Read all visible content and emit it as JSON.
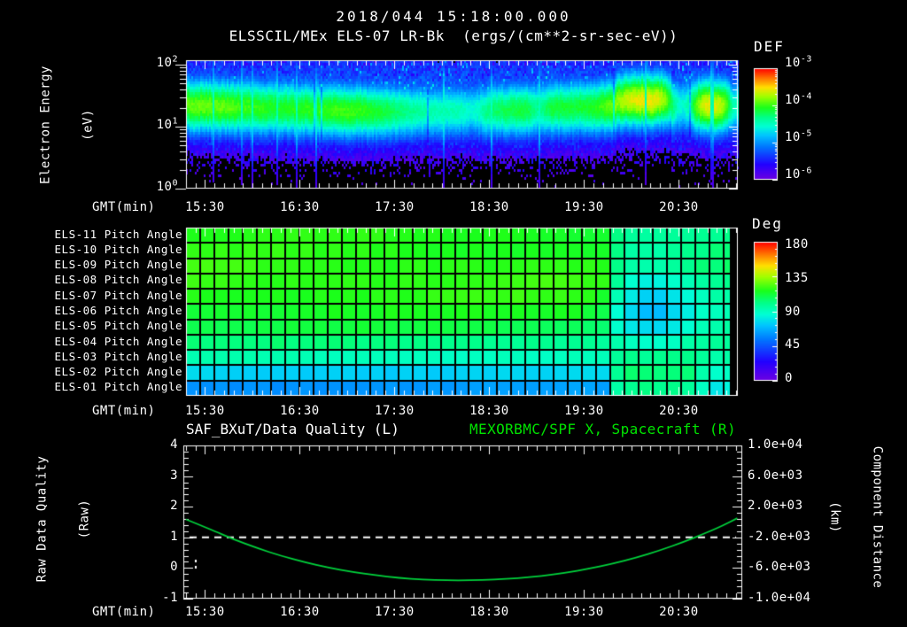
{
  "header": {
    "date_title": "2018/044 15:18:00.000",
    "instrument_title": "ELSSCIL/MEx ELS-07 LR-Bk  (ergs/(cm**2-sr-sec-eV))"
  },
  "colors": {
    "background": "#000000",
    "text": "#ffffff",
    "title_green": "#00e400",
    "curve_green": "#00d23c",
    "frame_white": "#ffffff",
    "grid_line": "#000000",
    "quality_line": "#ffffff"
  },
  "colormap_stops": [
    [
      0,
      "#7000e0"
    ],
    [
      0.14,
      "#2200ff"
    ],
    [
      0.3,
      "#0077ff"
    ],
    [
      0.4,
      "#00c4ff"
    ],
    [
      0.48,
      "#00ffd5"
    ],
    [
      0.56,
      "#00ff8c"
    ],
    [
      0.65,
      "#1aff1a"
    ],
    [
      0.75,
      "#a0ff00"
    ],
    [
      0.83,
      "#ffe000"
    ],
    [
      0.91,
      "#ff7a00"
    ],
    [
      1,
      "#ff0000"
    ]
  ],
  "time_axis": {
    "label": "GMT(min)",
    "tick_labels": [
      "15:30",
      "16:30",
      "17:30",
      "18:30",
      "19:30",
      "20:30"
    ],
    "tick_minutes": [
      12,
      72,
      132,
      192,
      252,
      312
    ],
    "start_time": "15:18",
    "minutes_span": 349
  },
  "spectrogram": {
    "ylabel_line1": "Electron Energy",
    "ylabel_line2": "(eV)",
    "ytick_labels": [
      {
        "base": "10",
        "exp": "2"
      },
      {
        "base": "10",
        "exp": "1"
      },
      {
        "base": "10",
        "exp": "0"
      }
    ]
  },
  "def_colorbar": {
    "label": "DEF",
    "tick_labels": [
      {
        "base": "10",
        "exp": "-3"
      },
      {
        "base": "10",
        "exp": "-4"
      },
      {
        "base": "10",
        "exp": "-5"
      },
      {
        "base": "10",
        "exp": "-6"
      }
    ]
  },
  "deg_colorbar": {
    "label": "Deg",
    "tick_labels": [
      "180",
      "135",
      "90",
      "45",
      "0"
    ]
  },
  "pitch": {
    "row_labels": [
      "ELS-11 Pitch Angle",
      "ELS-10 Pitch Angle",
      "ELS-09 Pitch Angle",
      "ELS-08 Pitch Angle",
      "ELS-07 Pitch Angle",
      "ELS-06 Pitch Angle",
      "ELS-05 Pitch Angle",
      "ELS-04 Pitch Angle",
      "ELS-03 Pitch Angle",
      "ELS-02 Pitch Angle",
      "ELS-01 Pitch Angle"
    ]
  },
  "bottom": {
    "title_left": "SAF_BXuT/Data Quality (L)",
    "title_right": "MEXORBMC/SPF X, Spacecraft (R)",
    "left_tick_labels": [
      "4",
      "3",
      "2",
      "1",
      "0",
      "-1"
    ],
    "right_tick_labels": [
      "1.0e+04",
      "6.0e+03",
      "2.0e+03",
      "-2.0e+03",
      "-6.0e+03",
      "-1.0e+04"
    ],
    "ylabel_left_line1": "Raw Data Quality",
    "ylabel_left_line2": "(Raw)",
    "ylabel_right_line1": "Component Distance",
    "ylabel_right_line2": "(km)"
  },
  "chart_data": [
    {
      "type": "heatmap",
      "panel": "electron_energy_spectrogram",
      "title": "ELSSCIL/MEx ELS-07 LR-Bk",
      "units": "ergs/(cm**2-sr-sec-eV)",
      "xlabel": "GMT(min)",
      "x_ticks": [
        "15:30",
        "16:30",
        "17:30",
        "18:30",
        "19:30",
        "20:30"
      ],
      "x_range": [
        "15:18",
        "21:07"
      ],
      "ylabel": "Electron Energy (eV)",
      "y_scale": "log",
      "y_range_ev": [
        1,
        117
      ],
      "colorbar": {
        "label": "DEF",
        "range_exponents": [
          -6,
          -3
        ]
      },
      "description": "Broad enhanced electron flux band between ~10 and ~60 eV near the 1e-4 level (green) across the whole interval; blue ~1e-5 speckle above the band; violet/black noise below ~8 eV; brighter yellow-green patches near 19:55-20:25 and 20:45-21:00; dim cyan gap near 20:35; narrow tall cyan streaks near 15:25, 18:15, 19:00 and 20:40.",
      "render": {
        "band_center_log_ev": 1.3,
        "band_sigma": 0.35,
        "peak_level": 0.68,
        "brightness_features": [
          [
            0.82,
            0.045,
            0.2
          ],
          [
            0.955,
            0.024,
            0.17
          ],
          [
            0.9,
            0.018,
            -0.42
          ],
          [
            0.64,
            0.012,
            -0.12
          ],
          [
            0.52,
            0.012,
            -0.1
          ],
          [
            0.995,
            0.008,
            -0.25
          ]
        ]
      }
    },
    {
      "type": "heatmap",
      "panel": "pitch_angle_grid",
      "rows": [
        "ELS-11",
        "ELS-10",
        "ELS-09",
        "ELS-08",
        "ELS-07",
        "ELS-06",
        "ELS-05",
        "ELS-04",
        "ELS-03",
        "ELS-02",
        "ELS-01"
      ],
      "colorbar": {
        "label": "Deg",
        "range": [
          0,
          180
        ]
      },
      "n_time_bins": 39,
      "row_mean_angle_deg_before_transition": [
        117,
        118,
        120,
        121,
        119,
        115,
        110,
        102,
        92,
        76,
        62
      ],
      "row_mean_angle_deg_after_transition": [
        101,
        102,
        103,
        100,
        97,
        95,
        97,
        100,
        103,
        104,
        100
      ],
      "transition_x_frac": 0.775,
      "transition_time": "~19:58",
      "blobs": [
        {
          "x_frac": 0.845,
          "row": 4.5,
          "x_sigma": 0.05,
          "row_sigma": 2.0,
          "depth_deg": 24
        },
        {
          "x_frac": 0.968,
          "row": 9.7,
          "x_sigma": 0.028,
          "row_sigma": 1.3,
          "depth_deg": 22
        }
      ],
      "no_data_x_frac": [
        0.986,
        1.0
      ]
    },
    {
      "type": "line",
      "panel": "quality_and_spacecraft_distance",
      "left_axis": {
        "label": "Raw Data Quality (Raw)",
        "range": [
          -1,
          4
        ]
      },
      "right_axis": {
        "label": "Component Distance (km)",
        "range": [
          -10000,
          10000
        ]
      },
      "series": [
        {
          "name": "SAF_BXuT/Data Quality (L)",
          "axis": "left",
          "style": "dashed",
          "color": "#ffffff",
          "value_constant": 1
        },
        {
          "name": "MEXORBMC/SPF X, Spacecraft (R)",
          "axis": "right",
          "style": "solid",
          "color": "#00d23c",
          "points_min_km": [
            [
              0,
              350
            ],
            [
              15,
              -900
            ],
            [
              30,
              -2250
            ],
            [
              45,
              -3400
            ],
            [
              60,
              -4400
            ],
            [
              75,
              -5250
            ],
            [
              90,
              -5950
            ],
            [
              105,
              -6500
            ],
            [
              120,
              -6950
            ],
            [
              135,
              -7300
            ],
            [
              150,
              -7520
            ],
            [
              165,
              -7610
            ],
            [
              180,
              -7610
            ],
            [
              195,
              -7520
            ],
            [
              210,
              -7330
            ],
            [
              225,
              -7030
            ],
            [
              240,
              -6620
            ],
            [
              255,
              -6100
            ],
            [
              270,
              -5450
            ],
            [
              285,
              -4650
            ],
            [
              300,
              -3700
            ],
            [
              315,
              -2600
            ],
            [
              330,
              -1350
            ],
            [
              340,
              -450
            ],
            [
              349,
              500
            ]
          ]
        }
      ],
      "stray_points_left_axis": [
        [
          5.5,
          0.26
        ],
        [
          5.5,
          0.06
        ]
      ]
    }
  ]
}
